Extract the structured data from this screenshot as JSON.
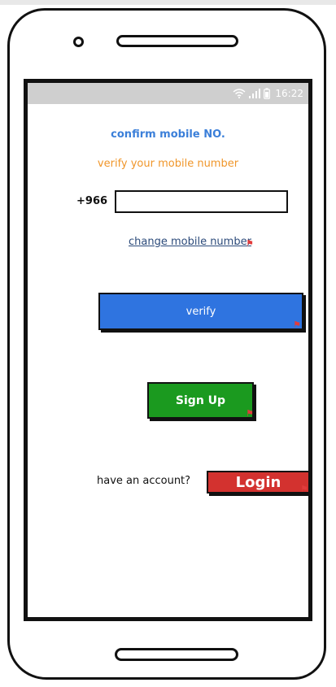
{
  "status_bar": {
    "time": "16:22",
    "wifi_icon": "wifi-icon",
    "signal_icon": "signal-icon",
    "battery_icon": "battery-icon"
  },
  "screen": {
    "title": "confirm mobile NO.",
    "subtitle": "verify your mobile number",
    "country_code": "+966",
    "phone_input_value": "",
    "change_link": "change mobile number",
    "verify_label": "verify",
    "signup_label": "Sign Up",
    "account_text": "have an account?",
    "login_label": "Login"
  },
  "colors": {
    "title": "#3b7fd9",
    "subtitle": "#f0962a",
    "verify_button": "#2f74e0",
    "signup_button": "#1b9a1f",
    "login_button": "#d3322f",
    "status_bar": "#cfcfcf"
  }
}
